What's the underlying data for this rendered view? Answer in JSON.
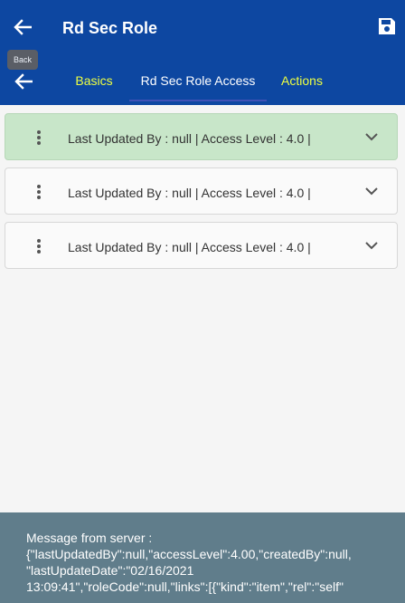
{
  "appbar": {
    "title": "Rd Sec Role",
    "back_icon": "arrow-left-icon",
    "save_icon": "floppy-disk-icon",
    "color": "#0d47a1"
  },
  "tooltip": {
    "text": "Back"
  },
  "tabs": {
    "back_icon": "arrow-left-icon",
    "items": [
      {
        "label": "Basics"
      },
      {
        "label": "Rd Sec Role Access"
      },
      {
        "label": "Actions"
      }
    ],
    "active_index": 1,
    "inactive_color": "#eeff41",
    "indicator_color": "#3f51b5"
  },
  "rows": [
    {
      "text": "Last Updated By  : null | Access Level  : 4.0 |",
      "selected": true,
      "menu_icon": "more-vertical-icon",
      "expand_icon": "chevron-down-icon"
    },
    {
      "text": "Last Updated By  : null | Access Level  : 4.0 |",
      "selected": false,
      "menu_icon": "more-vertical-icon",
      "expand_icon": "chevron-down-icon"
    },
    {
      "text": "Last Updated By  : null | Access Level  : 4.0 |",
      "selected": false,
      "menu_icon": "more-vertical-icon",
      "expand_icon": "chevron-down-icon"
    }
  ],
  "toast": {
    "lines": [
      "Message from server :",
      "{\"lastUpdatedBy\":null,\"accessLevel\":4.00,\"createdBy\":null,",
      "\"lastUpdateDate\":\"02/16/2021",
      "13:09:41\",\"roleCode\":null,\"links\":[{\"kind\":\"item\",\"rel\":\"self\""
    ],
    "color": "#607d8b"
  }
}
